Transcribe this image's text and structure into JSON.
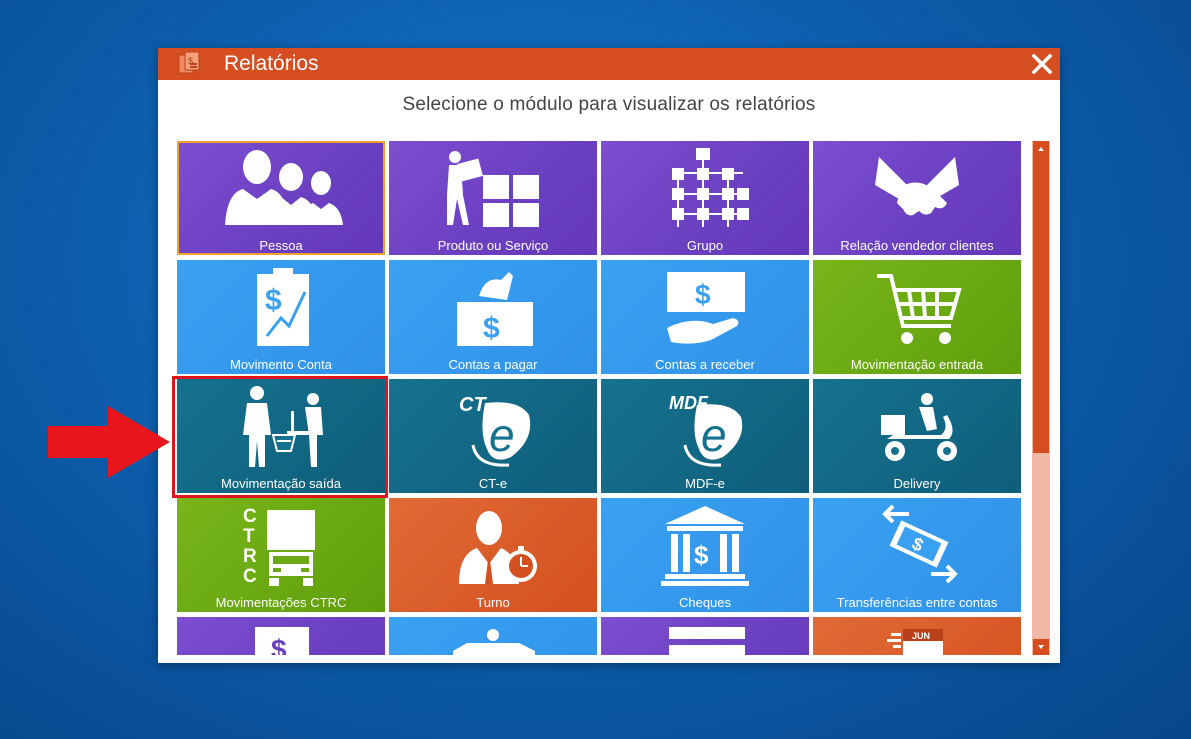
{
  "window": {
    "title": "Relatórios",
    "subtitle": "Selecione o módulo para visualizar os relatórios"
  },
  "tiles": [
    {
      "label": "Pessoa",
      "icon": "people-icon",
      "color": "purple"
    },
    {
      "label": "Produto ou Serviço",
      "icon": "delivery-boxes-icon",
      "color": "purple"
    },
    {
      "label": "Grupo",
      "icon": "hierarchy-icon",
      "color": "purple"
    },
    {
      "label": "Relação vendedor clientes",
      "icon": "handshake-icon",
      "color": "purple"
    },
    {
      "label": "Movimento Conta",
      "icon": "account-chart-icon",
      "color": "blue"
    },
    {
      "label": "Contas a pagar",
      "icon": "pay-money-icon",
      "color": "blue"
    },
    {
      "label": "Contas a receber",
      "icon": "receive-money-icon",
      "color": "blue"
    },
    {
      "label": "Movimentação entrada",
      "icon": "shopping-cart-icon",
      "color": "green"
    },
    {
      "label": "Movimentação saída",
      "icon": "checkout-icon",
      "color": "teal"
    },
    {
      "label": "CT-e",
      "icon": "cte-icon",
      "color": "teal",
      "badge": "CT",
      "glyph": "e"
    },
    {
      "label": "MDF-e",
      "icon": "mdfe-icon",
      "color": "teal",
      "badge": "MDF",
      "glyph": "e"
    },
    {
      "label": "Delivery",
      "icon": "scooter-icon",
      "color": "teal"
    },
    {
      "label": "Movimentações CTRC",
      "icon": "ctrc-truck-icon",
      "color": "green",
      "letters": [
        "C",
        "T",
        "R",
        "C"
      ]
    },
    {
      "label": "Turno",
      "icon": "shift-icon",
      "color": "orange"
    },
    {
      "label": "Cheques",
      "icon": "bank-icon",
      "color": "blue"
    },
    {
      "label": "Transferências entre contas",
      "icon": "transfer-icon",
      "color": "blue"
    },
    {
      "label": "",
      "icon": "money-icon",
      "color": "purple"
    },
    {
      "label": "",
      "icon": "ambulance-icon",
      "color": "blue"
    },
    {
      "label": "",
      "icon": "document-icon",
      "color": "purple"
    },
    {
      "label": "",
      "icon": "calendar-icon",
      "color": "orange",
      "month": "JUN"
    }
  ],
  "selected_index": 0,
  "highlighted_index": 8
}
